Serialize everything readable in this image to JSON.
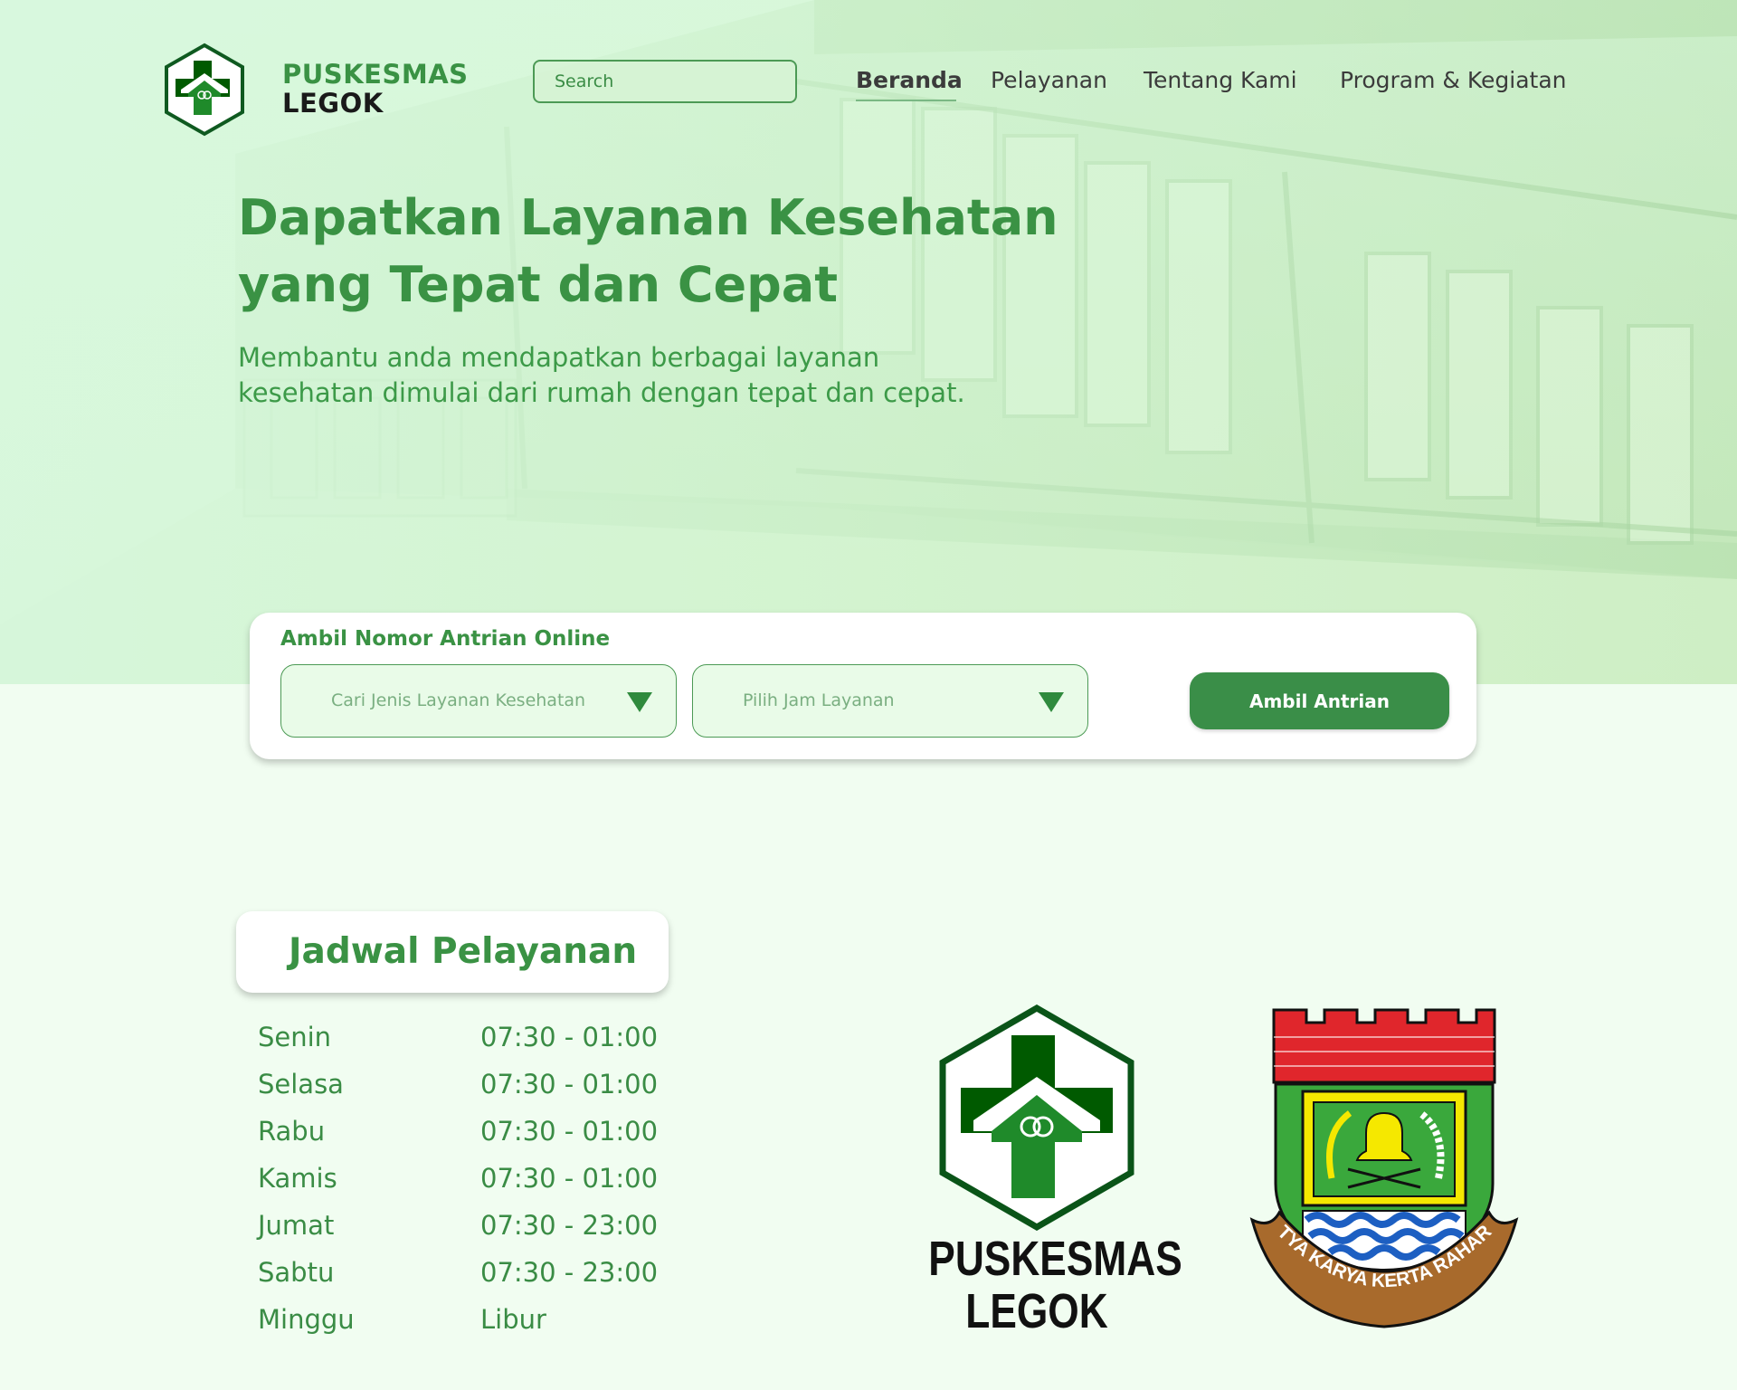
{
  "brand": {
    "line1": "PUSKESMAS",
    "line2": "LEGOK"
  },
  "search": {
    "placeholder": "Search"
  },
  "nav": {
    "items": [
      "Beranda",
      "Pelayanan",
      "Tentang Kami",
      "Program & Kegiatan"
    ],
    "active": "Beranda"
  },
  "hero": {
    "title_line1": "Dapatkan Layanan Kesehatan",
    "title_line2": "yang Tepat dan Cepat",
    "subtitle": "Membantu anda mendapatkan berbagai layanan kesehatan dimulai dari rumah dengan tepat dan cepat."
  },
  "queue": {
    "title": "Ambil Nomor Antrian Online",
    "service_select": "Cari Jenis Layanan Kesehatan",
    "time_select": "Pilih Jam Layanan",
    "button": "Ambil Antrian"
  },
  "schedule": {
    "title": "Jadwal Pelayanan",
    "rows": [
      {
        "day": "Senin",
        "time": "07:30 - 01:00"
      },
      {
        "day": "Selasa",
        "time": "07:30 - 01:00"
      },
      {
        "day": "Rabu",
        "time": "07:30 - 01:00"
      },
      {
        "day": "Kamis",
        "time": "07:30 - 01:00"
      },
      {
        "day": "Jumat",
        "time": "07:30 - 23:00"
      },
      {
        "day": "Sabtu",
        "time": "07:30 - 23:00"
      },
      {
        "day": "Minggu",
        "time": "Libur"
      }
    ]
  },
  "logos": {
    "puskesmas_line1": "PUSKESMAS",
    "puskesmas_line2": "LEGOK",
    "emblem_motto": "SATYA KARYA KERTA RAHARJA"
  },
  "colors": {
    "primary": "#3a9244",
    "button": "#3a8e48",
    "dark_green": "#005a00",
    "background": "#f1fdf1"
  },
  "icons": [
    "puskesmas-logo-icon",
    "dropdown-arrow-icon",
    "tangerang-emblem-icon"
  ]
}
